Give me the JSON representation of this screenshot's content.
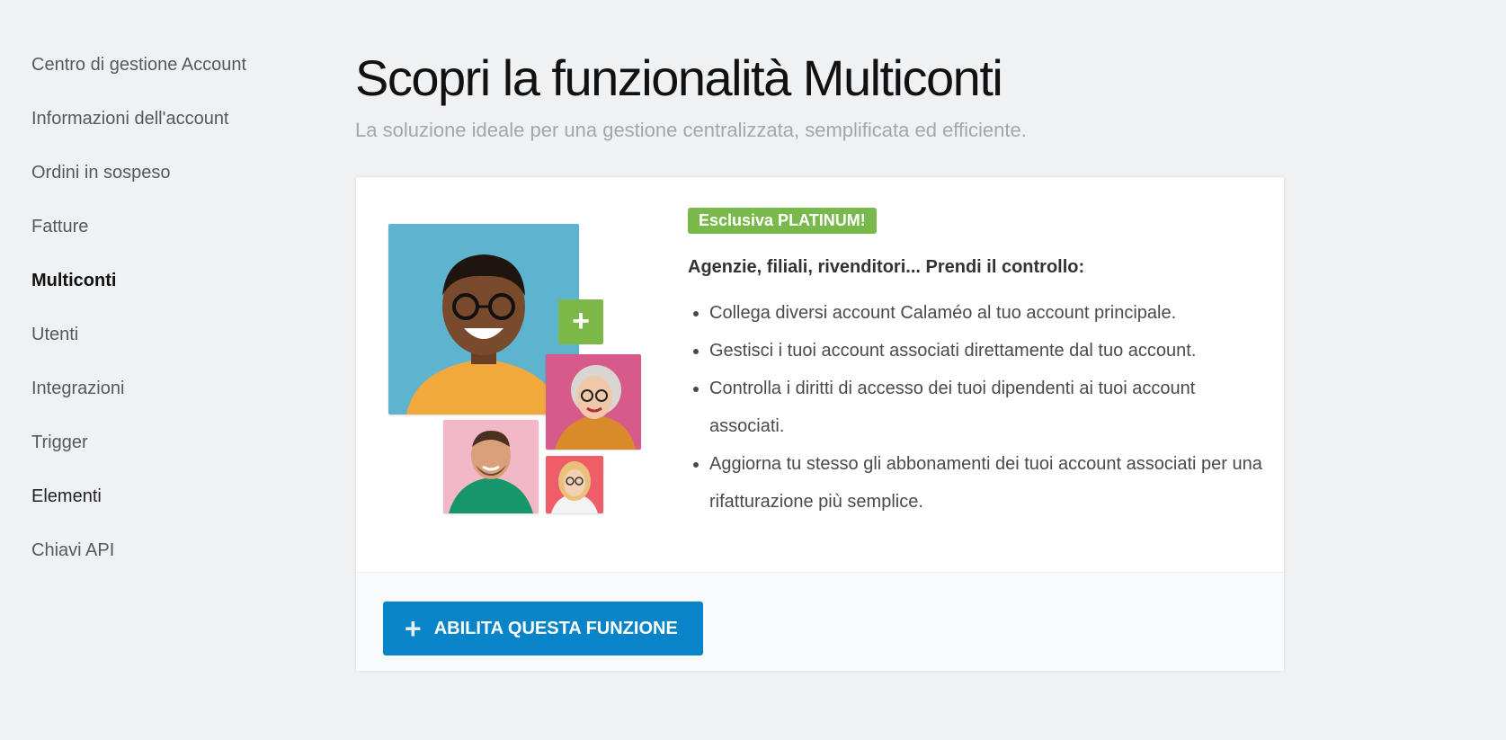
{
  "sidebar": {
    "items": [
      {
        "label": "Centro di gestione Account"
      },
      {
        "label": "Informazioni dell'account"
      },
      {
        "label": "Ordini in sospeso"
      },
      {
        "label": "Fatture"
      },
      {
        "label": "Multiconti"
      },
      {
        "label": "Utenti"
      },
      {
        "label": "Integrazioni"
      },
      {
        "label": "Trigger"
      },
      {
        "label": "Elementi"
      },
      {
        "label": "Chiavi API"
      }
    ],
    "active": "Multiconti"
  },
  "main": {
    "title": "Scopri la funzionalità Multiconti",
    "subtitle": "La soluzione ideale per una gestione centralizzata, semplificata ed efficiente."
  },
  "card": {
    "badge": "Esclusiva PLATINUM!",
    "headline": "Agenzie, filiali, rivenditori... Prendi il controllo:",
    "bullets": [
      "Collega diversi account Calaméo al tuo account principale.",
      "Gestisci i tuoi account associati direttamente dal tuo account.",
      "Controlla i diritti di accesso dei tuoi dipendenti ai tuoi account associati.",
      "Aggiorna tu stesso gli abbonamenti dei tuoi account associati per una rifatturazione più semplice."
    ],
    "plus_tile": "+",
    "enable_button": {
      "icon": "plus-icon",
      "label": "ABILITA QUESTA FUNZIONE"
    }
  },
  "colors": {
    "accent_blue": "#0a84c9",
    "badge_green": "#79b84a",
    "background": "#f0f1f3"
  }
}
